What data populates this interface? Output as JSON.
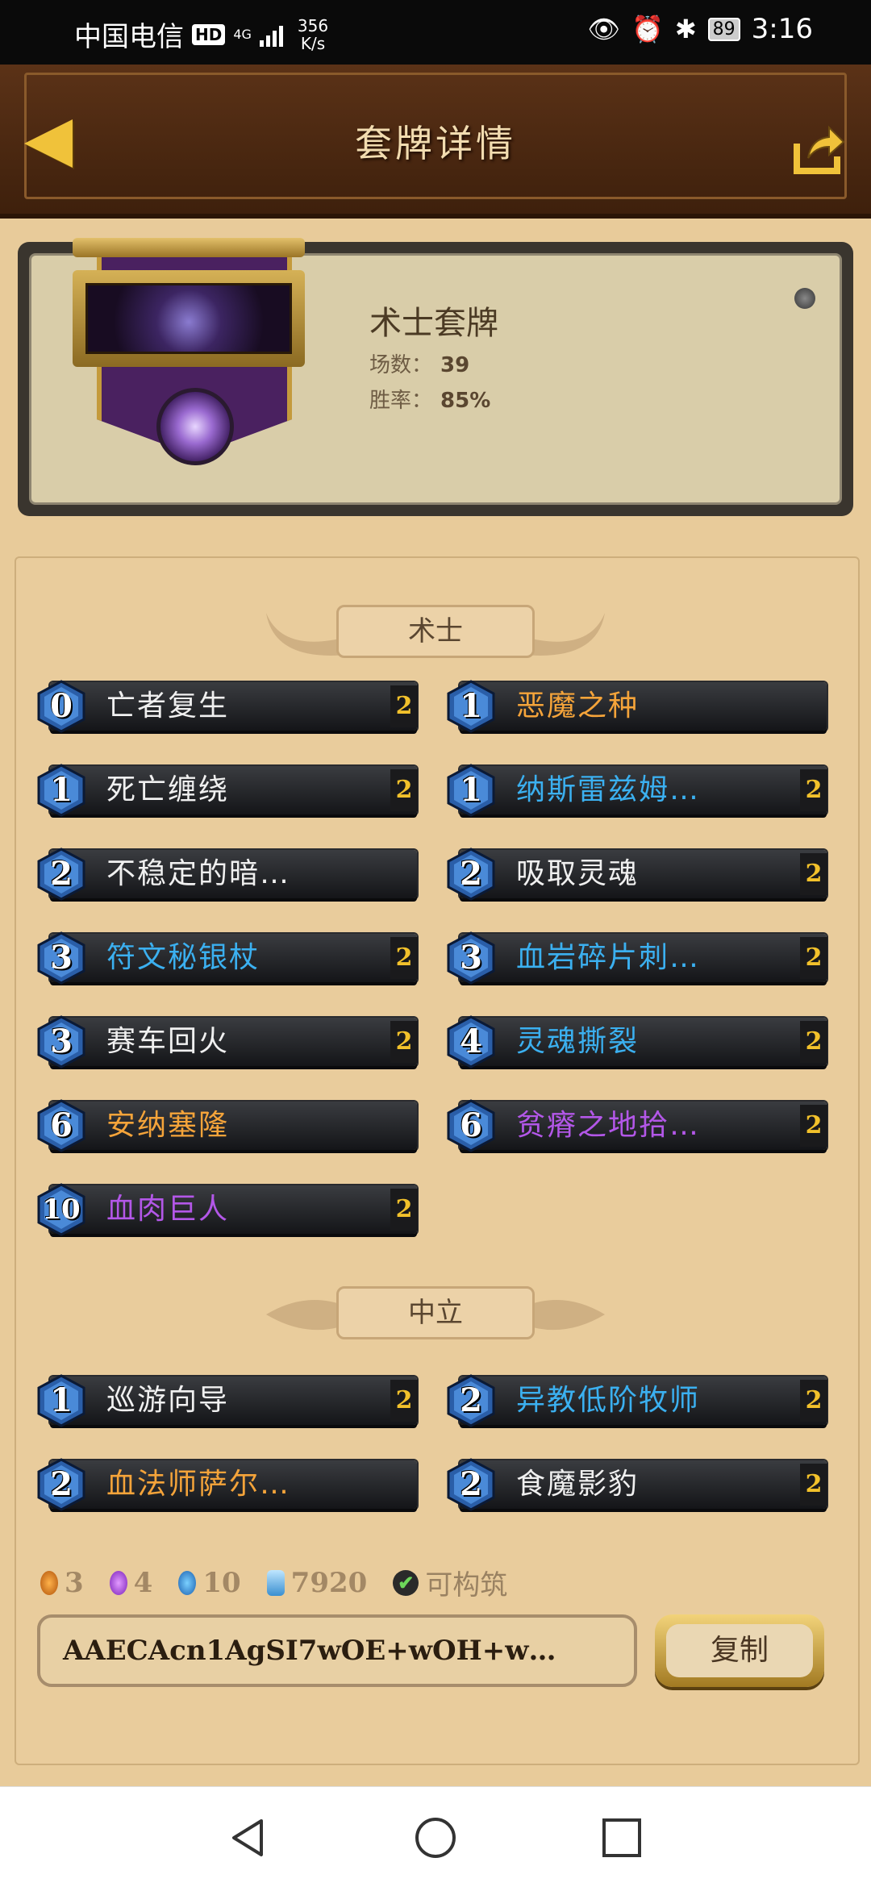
{
  "status_bar": {
    "carrier": "中国电信",
    "hd": "HD",
    "network": "4G",
    "speed_value": "356",
    "speed_unit": "K/s",
    "battery": "89",
    "time": "3:16"
  },
  "header": {
    "title": "套牌详情"
  },
  "deck": {
    "name": "术士套牌",
    "games_label": "场数：",
    "games_value": "39",
    "winrate_label": "胜率：",
    "winrate_value": "85%"
  },
  "sections": {
    "class_label": "术士",
    "neutral_label": "中立"
  },
  "colors": {
    "common": "#f0f0f0",
    "rare": "#3bb0f0",
    "epic": "#b357e8",
    "legendary": "#f5a43a"
  },
  "class_cards": [
    {
      "cost": "0",
      "name": "亡者复生",
      "count": "2",
      "rarity": "common"
    },
    {
      "cost": "1",
      "name": "恶魔之种",
      "count": "",
      "rarity": "legendary"
    },
    {
      "cost": "1",
      "name": "死亡缠绕",
      "count": "2",
      "rarity": "common"
    },
    {
      "cost": "1",
      "name": "纳斯雷兹姆…",
      "count": "2",
      "rarity": "rare"
    },
    {
      "cost": "2",
      "name": "不稳定的暗…",
      "count": "",
      "rarity": "common"
    },
    {
      "cost": "2",
      "name": "吸取灵魂",
      "count": "2",
      "rarity": "common"
    },
    {
      "cost": "3",
      "name": "符文秘银杖",
      "count": "2",
      "rarity": "rare"
    },
    {
      "cost": "3",
      "name": "血岩碎片刺…",
      "count": "2",
      "rarity": "rare"
    },
    {
      "cost": "3",
      "name": "赛车回火",
      "count": "2",
      "rarity": "common"
    },
    {
      "cost": "4",
      "name": "灵魂撕裂",
      "count": "2",
      "rarity": "rare"
    },
    {
      "cost": "6",
      "name": "安纳塞隆",
      "count": "",
      "rarity": "legendary"
    },
    {
      "cost": "6",
      "name": "贫瘠之地拾…",
      "count": "2",
      "rarity": "epic"
    },
    {
      "cost": "10",
      "name": "血肉巨人",
      "count": "2",
      "rarity": "epic"
    }
  ],
  "neutral_cards": [
    {
      "cost": "1",
      "name": "巡游向导",
      "count": "2",
      "rarity": "common"
    },
    {
      "cost": "2",
      "name": "异教低阶牧师",
      "count": "2",
      "rarity": "rare"
    },
    {
      "cost": "2",
      "name": "血法师萨尔…",
      "count": "",
      "rarity": "legendary"
    },
    {
      "cost": "2",
      "name": "食魔影豹",
      "count": "2",
      "rarity": "common"
    }
  ],
  "summary": {
    "legendary_count": "3",
    "epic_count": "4",
    "rare_count": "10",
    "dust": "7920",
    "craftable": "可构筑"
  },
  "deck_code": "AAECAcn1AgSI7wOE+wOH+w…",
  "copy_label": "复制"
}
